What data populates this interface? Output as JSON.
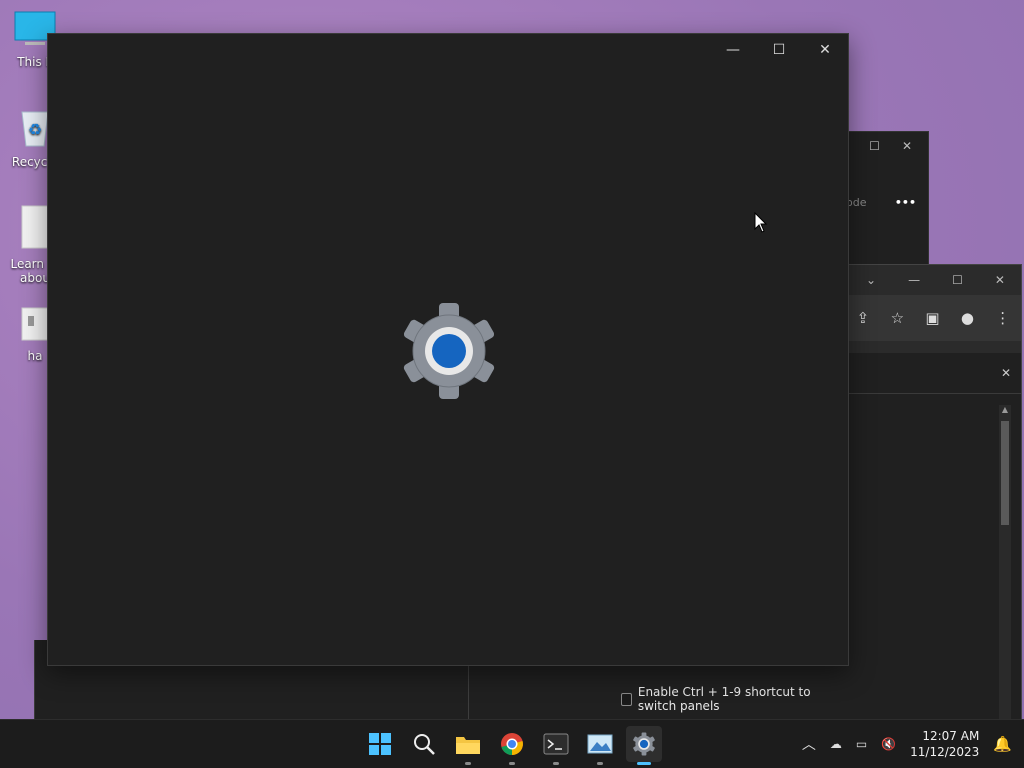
{
  "desktop": {
    "icons": [
      {
        "label": "This P",
        "icon": "monitor-icon"
      },
      {
        "label": "Recycle",
        "icon": "recycle-bin-icon"
      },
      {
        "label": "Learn m abou",
        "icon": "document-icon"
      },
      {
        "label": "ha",
        "icon": "file-icon"
      }
    ]
  },
  "background_window": {
    "partial_text": "ode",
    "more_label": "•••"
  },
  "chrome_window": {
    "icons": [
      "share-icon",
      "star-icon",
      "sidebar-icon",
      "profile-icon",
      "menu-icon"
    ]
  },
  "settings_panel": {
    "checkbox_label": "Enable Ctrl + 1-9 shortcut to switch panels",
    "checkbox_checked": false
  },
  "main_window": {
    "title": "",
    "splash_icon": "settings-gear-icon",
    "controls": {
      "minimize": "—",
      "maximize": "☐",
      "close": "✕"
    }
  },
  "taskbar": {
    "apps": [
      {
        "name": "start",
        "icon": "windows-start-icon"
      },
      {
        "name": "search",
        "icon": "search-icon"
      },
      {
        "name": "file-explorer",
        "icon": "folder-icon"
      },
      {
        "name": "chrome",
        "icon": "chrome-icon"
      },
      {
        "name": "terminal",
        "icon": "terminal-icon"
      },
      {
        "name": "photos",
        "icon": "image-icon"
      },
      {
        "name": "settings",
        "icon": "settings-gear-icon",
        "active": true
      }
    ],
    "tray": {
      "time": "12:07 AM",
      "date": "11/12/2023"
    }
  },
  "colors": {
    "accent": "#4cc2ff",
    "window_bg": "#202020",
    "taskbar_bg": "#1c1c1c",
    "gear_blue": "#1565c0"
  }
}
